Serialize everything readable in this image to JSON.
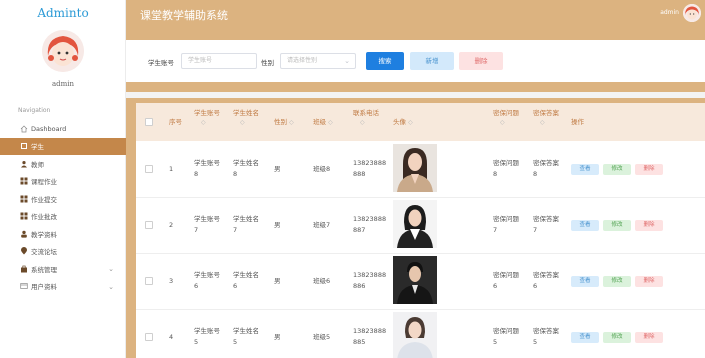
{
  "app": {
    "logo": "Adminto",
    "username": "admin",
    "title": "课堂教学辅助系统",
    "header_user": "admin"
  },
  "sidebar": {
    "section_title": "Navigation",
    "items": [
      {
        "label": "Dashboard",
        "icon": "home-icon"
      },
      {
        "label": "学生",
        "icon": "grid-icon",
        "active": true
      },
      {
        "label": "教师",
        "icon": "user-icon"
      },
      {
        "label": "课程作业",
        "icon": "grid-icon"
      },
      {
        "label": "作业提交",
        "icon": "grid-icon"
      },
      {
        "label": "作业批改",
        "icon": "grid-icon"
      },
      {
        "label": "教学资料",
        "icon": "person-icon"
      },
      {
        "label": "交流论坛",
        "icon": "pin-icon"
      },
      {
        "label": "系统管理",
        "icon": "bag-icon",
        "has_children": true
      },
      {
        "label": "用户资料",
        "icon": "card-icon",
        "has_children": true
      }
    ]
  },
  "search": {
    "account_label": "学生账号",
    "account_placeholder": "学生账号",
    "gender_label": "性别",
    "gender_placeholder": "请选择性别",
    "search_btn": "搜索",
    "add_btn": "新增",
    "delete_btn": "删除"
  },
  "table": {
    "headers": {
      "index": "序号",
      "account": "学生账号",
      "name": "学生姓名",
      "gender": "性别",
      "class": "班级",
      "phone": "联系电话",
      "avatar": "头像",
      "question": "密保问题",
      "answer": "密保答案",
      "ops": "操作"
    },
    "rows": [
      {
        "index": "1",
        "account": "学生账号",
        "account_n": "8",
        "name": "学生姓名",
        "name_n": "8",
        "gender": "男",
        "class": "班级8",
        "phone1": "13823888",
        "phone2": "888",
        "q": "密保问题",
        "q_n": "8",
        "a": "密保答案",
        "a_n": "8"
      },
      {
        "index": "2",
        "account": "学生账号",
        "account_n": "7",
        "name": "学生姓名",
        "name_n": "7",
        "gender": "男",
        "class": "班级7",
        "phone1": "13823888",
        "phone2": "887",
        "q": "密保问题",
        "q_n": "7",
        "a": "密保答案",
        "a_n": "7"
      },
      {
        "index": "3",
        "account": "学生账号",
        "account_n": "6",
        "name": "学生姓名",
        "name_n": "6",
        "gender": "男",
        "class": "班级6",
        "phone1": "13823888",
        "phone2": "886",
        "q": "密保问题",
        "q_n": "6",
        "a": "密保答案",
        "a_n": "6"
      },
      {
        "index": "4",
        "account": "学生账号",
        "account_n": "5",
        "name": "学生姓名",
        "name_n": "5",
        "gender": "男",
        "class": "班级5",
        "phone1": "13823888",
        "phone2": "885",
        "q": "密保问题",
        "q_n": "5",
        "a": "密保答案",
        "a_n": "5"
      }
    ],
    "actions": {
      "view": "查看",
      "edit": "修改",
      "delete": "删除"
    },
    "sort_glyph": "◇"
  },
  "colors": {
    "accent": "#dcb380",
    "active_nav": "#c4874a",
    "primary": "#1e7fe0",
    "header_text": "#c07b44"
  }
}
